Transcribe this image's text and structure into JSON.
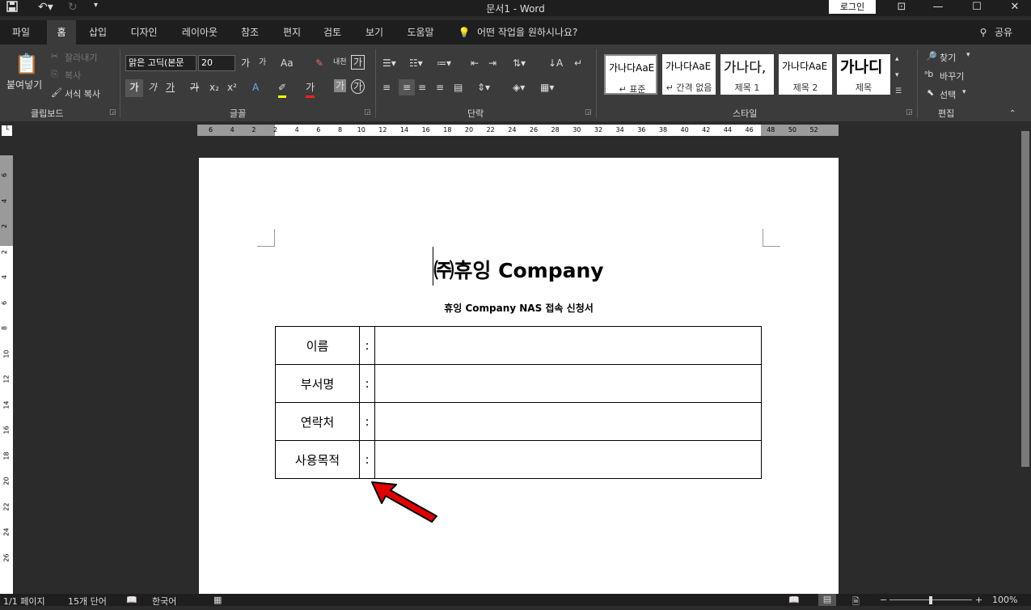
{
  "window": {
    "title": "문서1  -  Word",
    "login": "로그인"
  },
  "tabs": [
    {
      "label": "파일"
    },
    {
      "label": "홈"
    },
    {
      "label": "삽입"
    },
    {
      "label": "디자인"
    },
    {
      "label": "레이아웃"
    },
    {
      "label": "참조"
    },
    {
      "label": "편지"
    },
    {
      "label": "검토"
    },
    {
      "label": "보기"
    },
    {
      "label": "도움말"
    }
  ],
  "tell_me": "어떤 작업을 원하시나요?",
  "share": "공유",
  "clipboard": {
    "paste": "붙여넣기",
    "cut": "잘라내기",
    "copy": "복사",
    "format_painter": "서식 복사",
    "group": "클립보드"
  },
  "font": {
    "name": "맑은 고딕(본문",
    "size": "20",
    "group": "글꼴",
    "grow": "가",
    "shrink": "가",
    "case": "Aa",
    "bold": "가",
    "italic": "가",
    "underline": "가",
    "strike": "가",
    "sub": "x₂",
    "sup": "x²",
    "color": "가",
    "char_shade": "가",
    "circle": "가"
  },
  "paragraph": {
    "group": "단락"
  },
  "styles": {
    "group": "스타일",
    "items": [
      {
        "sample": "가나다AaE",
        "name": "↵ 표준"
      },
      {
        "sample": "가나다AaE",
        "name": "↵ 간격 없음"
      },
      {
        "sample": "가나다,",
        "name": "제목 1"
      },
      {
        "sample": "가나다AaE",
        "name": "제목 2"
      },
      {
        "sample": "가나디",
        "name": "제목"
      }
    ]
  },
  "editing": {
    "find": "찾기",
    "replace": "바꾸기",
    "select": "선택",
    "group": "편집"
  },
  "ruler": {
    "h_numbers": [
      "6",
      "4",
      "2",
      "2",
      "4",
      "6",
      "8",
      "10",
      "12",
      "14",
      "16",
      "18",
      "20",
      "22",
      "24",
      "26",
      "28",
      "30",
      "32",
      "34",
      "36",
      "38",
      "40",
      "42",
      "44",
      "46",
      "48",
      "50",
      "52"
    ],
    "v_numbers": [
      "6",
      "4",
      "2",
      "2",
      "4",
      "6",
      "8",
      "10",
      "12",
      "14",
      "16",
      "18",
      "20",
      "22",
      "24",
      "26"
    ]
  },
  "document": {
    "title": "㈜휴잉  Company",
    "subtitle": "휴잉  Company  NAS  접속  신청서",
    "rows": [
      {
        "label": "이름",
        "colon": ":"
      },
      {
        "label": "부서명",
        "colon": ":"
      },
      {
        "label": "연락처",
        "colon": ":"
      },
      {
        "label": "사용목적",
        "colon": ":"
      }
    ]
  },
  "status": {
    "page": "1/1 페이지",
    "words": "15개 단어",
    "lang": "한국어",
    "zoom": "100%"
  }
}
